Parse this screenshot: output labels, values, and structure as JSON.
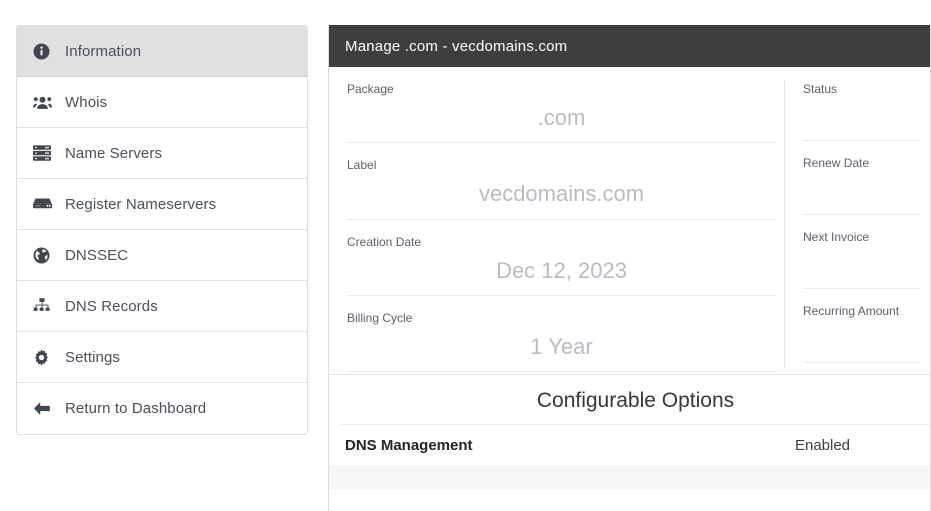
{
  "sidebar": {
    "items": [
      {
        "label": "Information",
        "icon": "info-circle-icon",
        "active": true
      },
      {
        "label": "Whois",
        "icon": "users-icon",
        "active": false
      },
      {
        "label": "Name Servers",
        "icon": "server-icon",
        "active": false
      },
      {
        "label": "Register Nameservers",
        "icon": "hdd-icon",
        "active": false
      },
      {
        "label": "DNSSEC",
        "icon": "globe-icon",
        "active": false
      },
      {
        "label": "DNS Records",
        "icon": "sitemap-icon",
        "active": false
      },
      {
        "label": "Settings",
        "icon": "gear-icon",
        "active": false
      },
      {
        "label": "Return to Dashboard",
        "icon": "arrow-left-icon",
        "active": false
      }
    ]
  },
  "panel": {
    "title": "Manage .com - vecdomains.com",
    "header_bg": "#3e3e3e",
    "left_fields": [
      {
        "label": "Package",
        "value": ".com"
      },
      {
        "label": "Label",
        "value": "vecdomains.com"
      },
      {
        "label": "Creation Date",
        "value": "Dec 12, 2023"
      },
      {
        "label": "Billing Cycle",
        "value": "1 Year"
      }
    ],
    "right_fields": [
      {
        "label": "Status",
        "value": ""
      },
      {
        "label": "Renew Date",
        "value": ""
      },
      {
        "label": "Next Invoice",
        "value": ""
      },
      {
        "label": "Recurring Amount",
        "value": ""
      }
    ],
    "configurable_options": {
      "title": "Configurable Options",
      "rows": [
        {
          "name": "DNS Management",
          "value": "Enabled"
        }
      ]
    }
  }
}
